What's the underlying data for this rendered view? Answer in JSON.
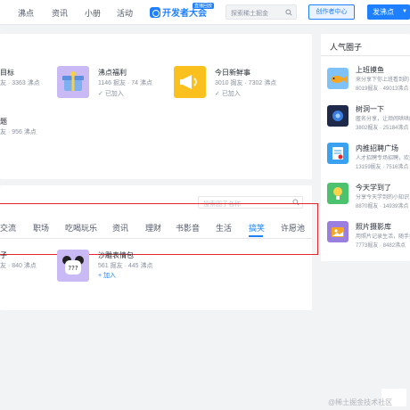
{
  "header": {
    "nav": [
      "沸点",
      "资讯",
      "小册",
      "活动"
    ],
    "brand_text": "开发者大会",
    "brand_badge": "直播回放",
    "search_placeholder": "探索稀土掘金",
    "creator_label": "创作者中心",
    "post_label": "发沸点"
  },
  "my_circles": [
    {
      "name": "目标",
      "meta": "友 · 3363 沸点"
    },
    {
      "name": "沸点福利",
      "meta": "1146 掘友 · 74 沸点",
      "status": "已加入"
    },
    {
      "name": "今日新鲜事",
      "meta": "3010 掘友 · 7302 沸点",
      "status": "已加入"
    },
    {
      "name": "题",
      "meta": "友 · 956 沸点"
    }
  ],
  "explore": {
    "search_placeholder": "搜索圈子名称",
    "tabs": [
      "交流",
      "职场",
      "吃喝玩乐",
      "资讯",
      "理财",
      "书影音",
      "生活",
      "搞笑",
      "许愿池"
    ],
    "active_tab": "搞笑",
    "results": [
      {
        "name": "子",
        "meta": "友 · 840 沸点"
      },
      {
        "name": "沙雕表情包",
        "meta": "561 掘友 · 445 沸点",
        "action": "加入"
      }
    ]
  },
  "sidebar": {
    "title": "人气圈子",
    "items": [
      {
        "name": "上班摸鱼",
        "desc": "来分享下你上班看到的",
        "meta": "8019掘友 · 49013沸点"
      },
      {
        "name": "树洞一下",
        "desc": "匿名分享，让烦闹哄哄的",
        "meta": "3802掘友 · 25184沸点"
      },
      {
        "name": "内推招聘广场",
        "desc": "人才招聘专场招聘，欢迎",
        "meta": "13159掘友 · 7516沸点"
      },
      {
        "name": "今天学到了",
        "desc": "分享今天学到的小知识，专",
        "meta": "8870掘友 · 14939沸点"
      },
      {
        "name": "照片摄影库",
        "desc": "用照片记录生活，随手拍",
        "meta": "7773掘友 · 8482沸点"
      }
    ]
  },
  "icons": {
    "search": "search-icon",
    "arrow": "chevron-down-icon"
  },
  "colors": {
    "accent": "#1e80ff",
    "highlight": "#e5252a"
  },
  "watermark": "@稀土掘金技术社区"
}
